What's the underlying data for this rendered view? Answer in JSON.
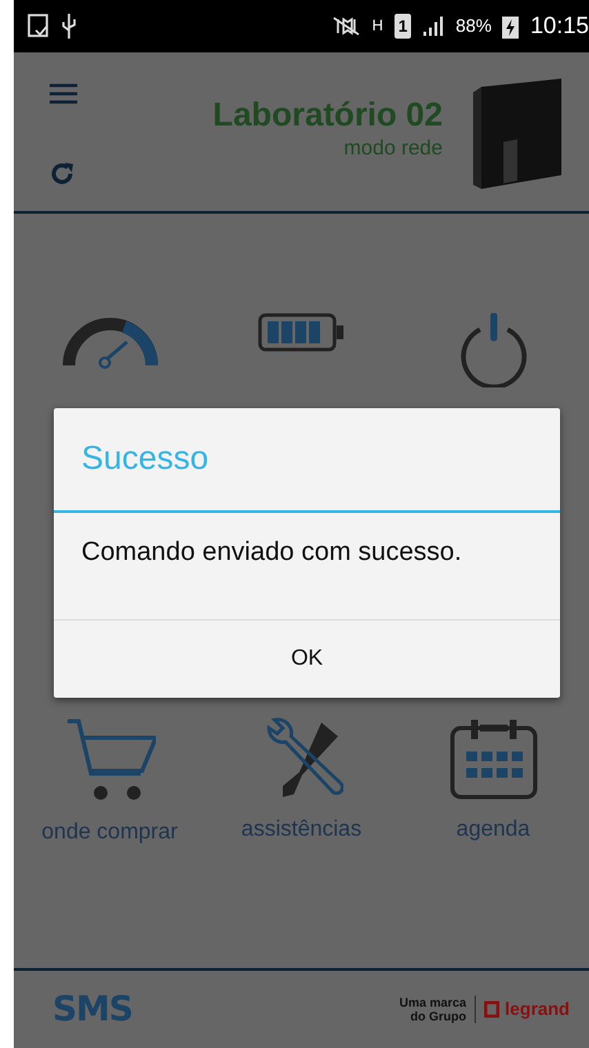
{
  "status_bar": {
    "network": "H",
    "sim": "1",
    "battery": "88%",
    "time": "10:15"
  },
  "header": {
    "title": "Laboratório 02",
    "subtitle": "modo rede"
  },
  "menu_rows": [
    [
      {
        "kind": "gauge"
      },
      {
        "kind": "battery"
      },
      {
        "kind": "power"
      }
    ],
    [],
    [
      {
        "kind": "cart",
        "label": "onde comprar"
      },
      {
        "kind": "tools",
        "label": "assistências"
      },
      {
        "kind": "calendar",
        "label": "agenda"
      }
    ]
  ],
  "dialog": {
    "title": "Sucesso",
    "message": "Comando enviado com sucesso.",
    "buttons": [
      "OK"
    ]
  },
  "footer": {
    "logo": "SMS",
    "tagline_1": "Uma marca",
    "tagline_2": "do Grupo",
    "brand": "legrand"
  }
}
